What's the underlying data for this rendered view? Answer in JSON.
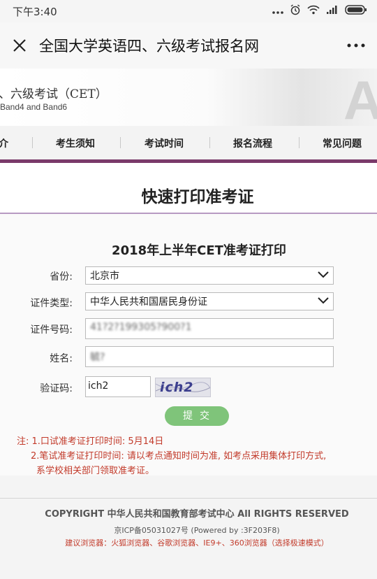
{
  "status_bar": {
    "time": "下午3:40",
    "icons": [
      "more-dots-icon",
      "alarm-icon",
      "wifi-icon",
      "signal-icon",
      "battery-icon"
    ]
  },
  "title_bar": {
    "title": "全国大学英语四、六级考试报名网",
    "close_icon": "close-icon",
    "more_icon": "more-icon"
  },
  "banner": {
    "title_cn": "、六级考试（CET）",
    "title_en": "Band4 and Band6",
    "logo_letter": "A"
  },
  "nav": {
    "items": [
      {
        "label": "介"
      },
      {
        "label": "考生须知"
      },
      {
        "label": "考试时间"
      },
      {
        "label": "报名流程"
      },
      {
        "label": "常见问题"
      }
    ],
    "accent_color": "#7a3a6a"
  },
  "page": {
    "headline": "快速打印准考证",
    "form_title": "2018年上半年CET准考证打印"
  },
  "form": {
    "province": {
      "label": "省份:",
      "value": "北京市"
    },
    "id_type": {
      "label": "证件类型:",
      "value": "中华人民共和国居民身份证"
    },
    "id_number": {
      "label": "证件号码:",
      "value": "41?2?199305?900?1"
    },
    "name": {
      "label": "姓名:",
      "value": "毓?"
    },
    "captcha": {
      "label": "验证码:",
      "value": "ich2",
      "image_text": "ich2"
    },
    "submit_label": "提交"
  },
  "notes": {
    "line1": "注: 1.口试准考证打印时间: 5月14日",
    "line2": "2.笔试准考证打印时间: 请以考点通知时间为准, 如考点采用集体打印方式,",
    "line3": "系学校相关部门领取准考证。",
    "color": "#c23a2a"
  },
  "footer": {
    "copyright": "COPYRIGHT 中华人民共和国教育部考试中心 All RIGHTS RESERVED",
    "icp": "京ICP备05031027号 (Powered by :3F203F8)",
    "browsers": "建议浏览器：火狐浏览器、谷歌浏览器、IE9+、360浏览器（选择极速模式）"
  },
  "colors": {
    "submit_button": "#7fc47a",
    "warning_text": "#c23a2a"
  }
}
